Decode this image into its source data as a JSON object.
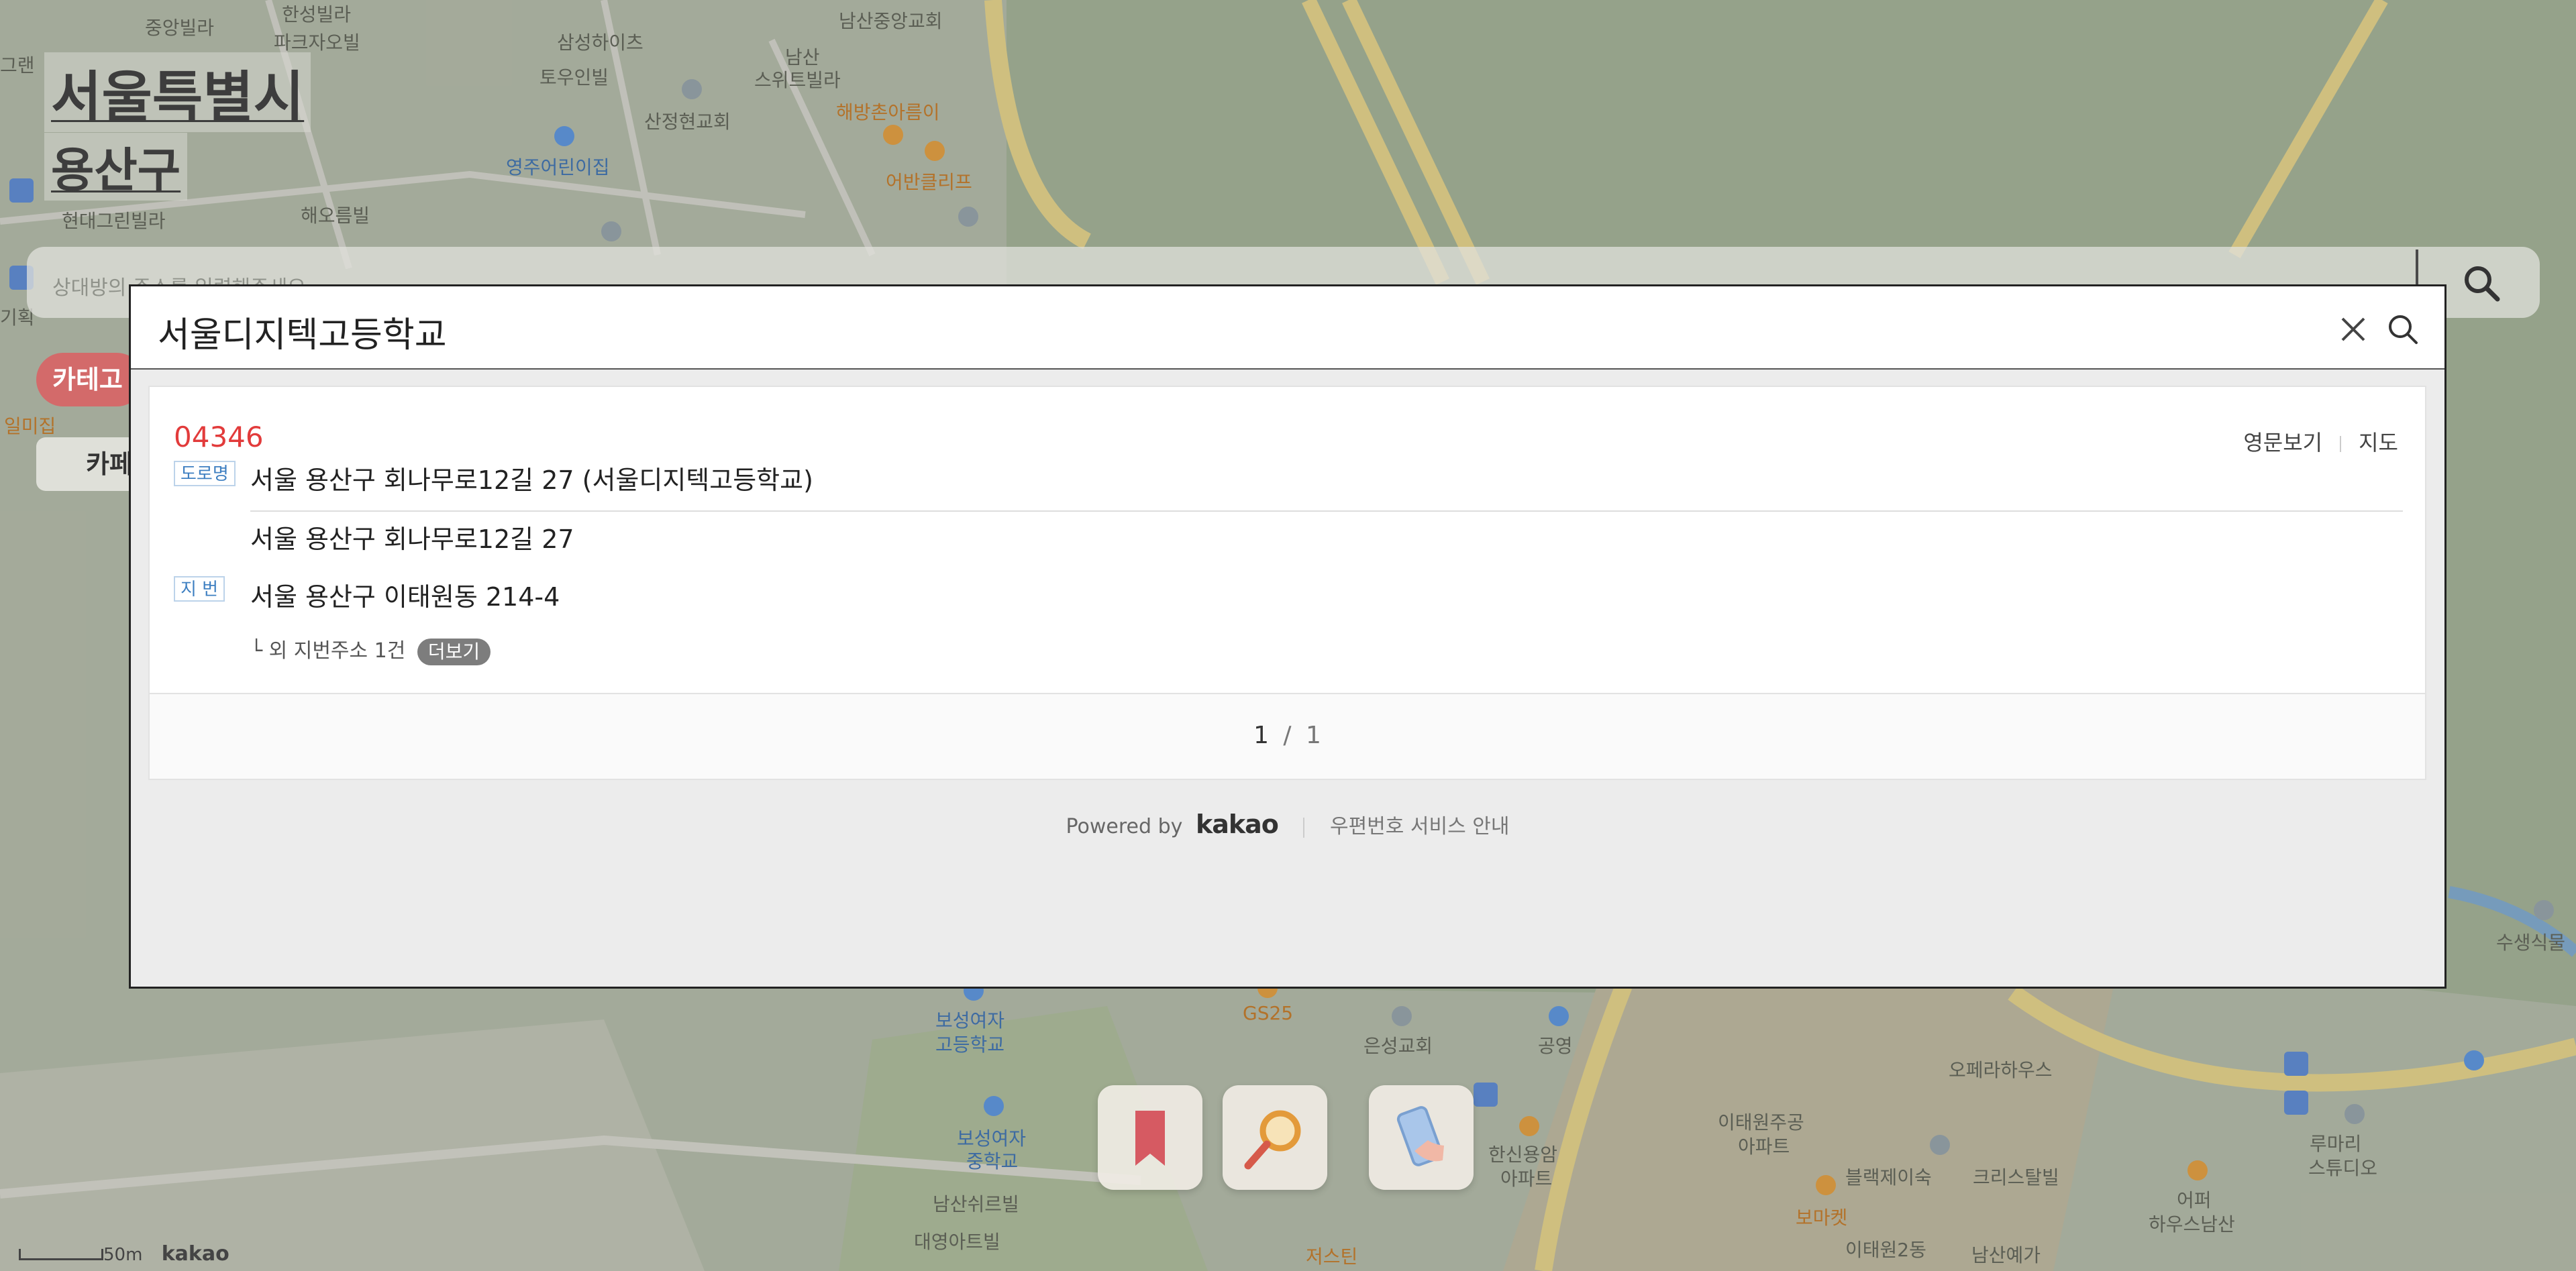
{
  "map": {
    "region_city": "서울특별시",
    "region_district": "용산구",
    "search_placeholder": "상대방의 주소를 입력해주세요",
    "category_chip": "카테고리",
    "cafe_chip": "카페",
    "scale_label": "50m",
    "attribution": "kakao",
    "labels": [
      {
        "text": "중앙빌라",
        "c": ""
      },
      {
        "text": "한성빌라",
        "c": ""
      },
      {
        "text": "파크자오빌",
        "c": ""
      },
      {
        "text": "삼성하이츠",
        "c": ""
      },
      {
        "text": "토우인빌",
        "c": ""
      },
      {
        "text": "남산중앙교회",
        "c": ""
      },
      {
        "text": "남산",
        "c": ""
      },
      {
        "text": "스위트빌라",
        "c": ""
      },
      {
        "text": "해방촌아름이",
        "c": "orange"
      },
      {
        "text": "산정현교회",
        "c": ""
      },
      {
        "text": "영주어린이집",
        "c": "blue"
      },
      {
        "text": "어반클리프",
        "c": "orange"
      },
      {
        "text": "해오름빌",
        "c": ""
      },
      {
        "text": "현대그린빌라",
        "c": ""
      },
      {
        "text": "그랜",
        "c": ""
      },
      {
        "text": "기획",
        "c": ""
      },
      {
        "text": "일미집",
        "c": "orange"
      },
      {
        "text": "보성여자",
        "c": "blue"
      },
      {
        "text": "고등학교",
        "c": "blue"
      },
      {
        "text": "GS25",
        "c": "orange"
      },
      {
        "text": "은성교회",
        "c": ""
      },
      {
        "text": "공영",
        "c": ""
      },
      {
        "text": "보성여자",
        "c": "blue"
      },
      {
        "text": "중학교",
        "c": "blue"
      },
      {
        "text": "남산쉬르빌",
        "c": ""
      },
      {
        "text": "대영아트빌",
        "c": ""
      },
      {
        "text": "이태원주공",
        "c": ""
      },
      {
        "text": "아파트",
        "c": ""
      },
      {
        "text": "한신용암",
        "c": ""
      },
      {
        "text": "아파트",
        "c": ""
      },
      {
        "text": "보마켓",
        "c": "orange"
      },
      {
        "text": "블랙제이숙",
        "c": ""
      },
      {
        "text": "크리스탈빌",
        "c": ""
      },
      {
        "text": "오페라하우스",
        "c": ""
      },
      {
        "text": "어퍼",
        "c": ""
      },
      {
        "text": "하우스남산",
        "c": ""
      },
      {
        "text": "루마리",
        "c": ""
      },
      {
        "text": "스튜디오",
        "c": ""
      },
      {
        "text": "남산예가",
        "c": ""
      },
      {
        "text": "이태원2동",
        "c": ""
      },
      {
        "text": "수생식물",
        "c": ""
      },
      {
        "text": "저스틴",
        "c": "orange"
      }
    ]
  },
  "dialog": {
    "query": "서울디지텍고등학교",
    "result": {
      "postcode": "04346",
      "road_badge": "도로명",
      "road_address": "서울 용산구 회나무로12길 27 (서울디지텍고등학교)",
      "road_address_short": "서울 용산구 회나무로12길 27",
      "jibun_badge": "지 번",
      "jibun_address": "서울 용산구 이태원동 214-4",
      "more_text": "└ 외 지번주소 1건",
      "more_button": "더보기",
      "english_link": "영문보기",
      "map_link": "지도"
    },
    "pager": {
      "current": "1",
      "separator": "/",
      "total": "1"
    },
    "footer": {
      "powered_by": "Powered by",
      "brand": "kakao",
      "guide": "우편번호 서비스 안내"
    }
  },
  "colors": {
    "postcode": "#e23b3b",
    "badge": "#3e7fc1",
    "category": "#d36a6a"
  }
}
